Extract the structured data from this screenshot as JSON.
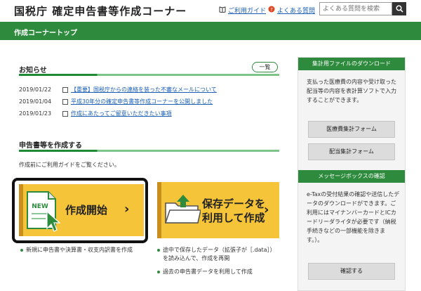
{
  "header": {
    "title": "国税庁 確定申告書等作成コーナー",
    "guide_link": "ご利用ガイド",
    "faq_link": "よくある質問",
    "search_placeholder": "よくある質問を検索"
  },
  "greenbar": {
    "title": "作成コーナートップ"
  },
  "news": {
    "heading": "お知らせ",
    "list_button": "一覧",
    "items": [
      {
        "date": "2019/01/22",
        "text": "【重要】国税庁からの連絡を装った不審なメールについて"
      },
      {
        "date": "2019/01/04",
        "text": "平成30年分の確定申告書等作成コーナーを公開しました"
      },
      {
        "date": "2019/01/23",
        "text": "作成にあたってご留意いただきたい事項"
      }
    ]
  },
  "create_section": {
    "heading": "申告書等を作成する",
    "guide_text": "作成前にご利用ガイドをご覧ください。",
    "new_badge": "NEW",
    "create_label": "作成開始",
    "load_label_line1": "保存データを",
    "load_label_line2": "利用して作成",
    "create_bullet": "新規に申告書や決算書・収支内訳書を作成",
    "load_bullet1_line1": "途中で保存したデータ（拡張子が［.data］）",
    "load_bullet1_line2": "を読み込んで、作成を再開",
    "load_bullet2": "過去の申告書データを利用して作成"
  },
  "sidebar": {
    "download_head": "集計用ファイルのダウンロード",
    "download_text": "支払った医療費の内容や受け取った配当等の内容を表計算ソフトで入力することができます。",
    "medical_button": "医療費集計フォーム",
    "dividend_button": "配当集計フォーム",
    "message_head": "メッセージボックスの確認",
    "message_text": "e-Taxの受付結果の確認や送信したデータのダウンロードができます。ご利用にはマイナンバーカードとICカードリーダライタが必要です（納税手続きなどの一部機能を除きます。）。",
    "confirm_button": "確認する"
  },
  "colors": {
    "accent_green": "#2e8b3e",
    "card_yellow": "#f5c438",
    "link_blue": "#1a5fb4"
  }
}
